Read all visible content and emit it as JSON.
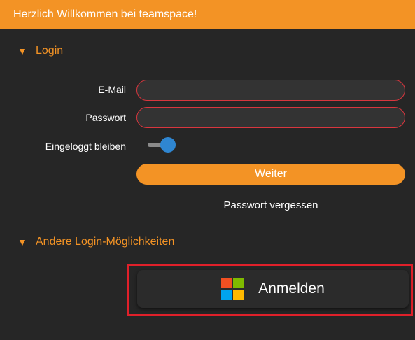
{
  "header": {
    "title": "Herzlich Willkommen bei teamspace!"
  },
  "login_section": {
    "toggle_icon": "triangle-down-icon",
    "title": "Login",
    "email_label": "E-Mail",
    "email_value": "",
    "password_label": "Passwort",
    "password_value": "",
    "stay_logged_in_label": "Eingeloggt bleiben",
    "stay_logged_in": true,
    "continue_label": "Weiter",
    "forgot_label": "Passwort vergessen"
  },
  "other_section": {
    "toggle_icon": "triangle-down-icon",
    "title": "Andere Login-Möglichkeiten",
    "microsoft_button_label": "Anmelden",
    "microsoft_icon": "microsoft-logo-icon"
  },
  "colors": {
    "accent": "#f39325",
    "background": "#262626",
    "error_border": "#d9363e",
    "toggle_on": "#2f86d1",
    "highlight": "#e0202a",
    "ms_red": "#f25022",
    "ms_green": "#7fba00",
    "ms_blue": "#00a4ef",
    "ms_yellow": "#ffb900"
  }
}
